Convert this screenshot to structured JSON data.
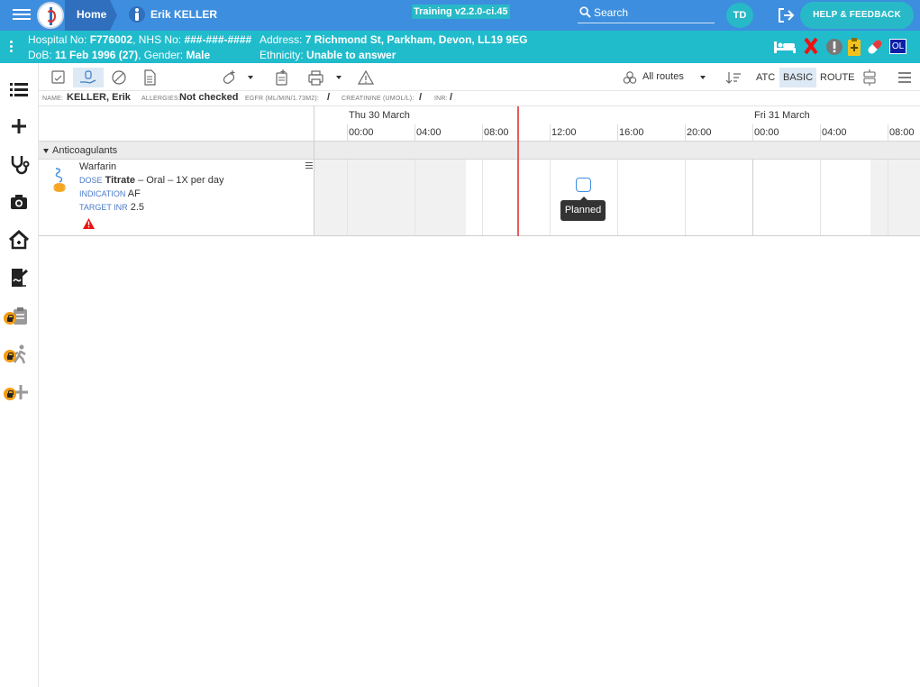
{
  "topbar": {
    "home_label": "Home",
    "patient_name": "Erik KELLER",
    "build": "Training v2.2.0-ci.45",
    "search_placeholder": "Search",
    "avatar_initials": "TD",
    "help_label": "HELP & FEEDBACK"
  },
  "banner": {
    "hospital_label": "Hospital No:",
    "hospital_no": "F776002",
    "nhs_label": "NHS No:",
    "nhs_no": "###-###-####",
    "address_label": "Address:",
    "address": "7 Richmond St, Parkham, Devon, LL19 9EG",
    "dob_label": "DoB:",
    "dob": "11 Feb 1996 (27)",
    "gender_label": "Gender:",
    "gender": "Male",
    "ethnicity_label": "Ethnicity:",
    "ethnicity": "Unable to answer",
    "badge_text": "OL",
    "colors": {
      "bar": "#3d8ede",
      "banner": "#20bccb",
      "accent": "#27b9c7"
    }
  },
  "leftnav": {
    "items": [
      "list-icon",
      "plus-icon",
      "stethoscope-icon",
      "camera-icon",
      "home-icon",
      "signature-icon",
      "clipboard-icon",
      "walking-icon",
      "add-icon"
    ],
    "locked": [
      "clipboard-icon",
      "walking-icon",
      "add-icon"
    ]
  },
  "toolbar": {
    "routes_label": "All routes",
    "atc_label": "ATC",
    "basic_label": "BASIC",
    "route_label": "ROUTE"
  },
  "info": {
    "name_label": "NAME:",
    "name_value": "KELLER, Erik",
    "allergies_label": "ALLERGIES:",
    "allergies_value": "Not checked",
    "egfr_label": "EGFR (ML/MIN/1.73M2):",
    "egfr_value": "/",
    "creatinine_label": "CREATININE (UMOL/L):",
    "creatinine_value": "/",
    "inr_label": "INR:",
    "inr_value": "/"
  },
  "timeline": {
    "days": [
      "Thu 30 March",
      "Fri 31 March"
    ],
    "hours": [
      "00:00",
      "04:00",
      "08:00",
      "12:00",
      "16:00",
      "20:00",
      "00:00",
      "04:00",
      "08:00"
    ]
  },
  "group": {
    "label": "Anticoagulants"
  },
  "medication": {
    "name": "Warfarin",
    "dose_label": "DOSE",
    "dose_value": "Titrate",
    "dose_rest": "– Oral – 1X per day",
    "indication_label": "INDICATION",
    "indication_value": "AF",
    "target_label": "TARGET INR",
    "target_value": "2.5",
    "slot_status": "Planned"
  }
}
